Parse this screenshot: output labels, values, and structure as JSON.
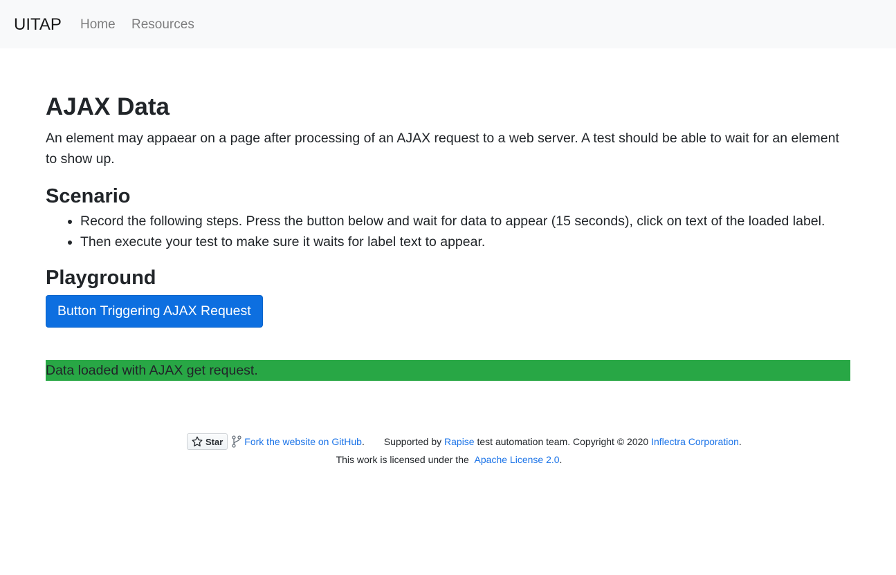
{
  "navbar": {
    "brand": "UITAP",
    "links": [
      "Home",
      "Resources"
    ]
  },
  "main": {
    "title": "AJAX Data",
    "intro": "An element may appaear on a page after processing of an AJAX request to a web server. A test should be able to wait for an element to show up.",
    "scenario_heading": "Scenario",
    "steps": [
      "Record the following steps. Press the button below and wait for data to appear (15 seconds), click on text of the loaded label.",
      "Then execute your test to make sure it waits for label text to appear."
    ],
    "playground_heading": "Playground",
    "button_label": "Button Triggering AJAX Request",
    "loaded_label": "Data loaded with AJAX get request."
  },
  "footer": {
    "star_label": "Star",
    "fork_link": "Fork the website on GitHub",
    "fork_suffix": ".",
    "supported_prefix": "Supported by ",
    "rapise_link": "Rapise",
    "supported_middle": " test automation team. Copyright © 2020 ",
    "inflectra_link": "Inflectra Corporation",
    "supported_suffix": ".",
    "license_prefix": "This work is licensed under the ",
    "license_link": "Apache License 2.0",
    "license_suffix": "."
  },
  "colors": {
    "navbar_bg": "#f8f9fa",
    "button_bg": "#0d6fe0",
    "success_bg": "#28a745",
    "link": "#1a73e8"
  }
}
